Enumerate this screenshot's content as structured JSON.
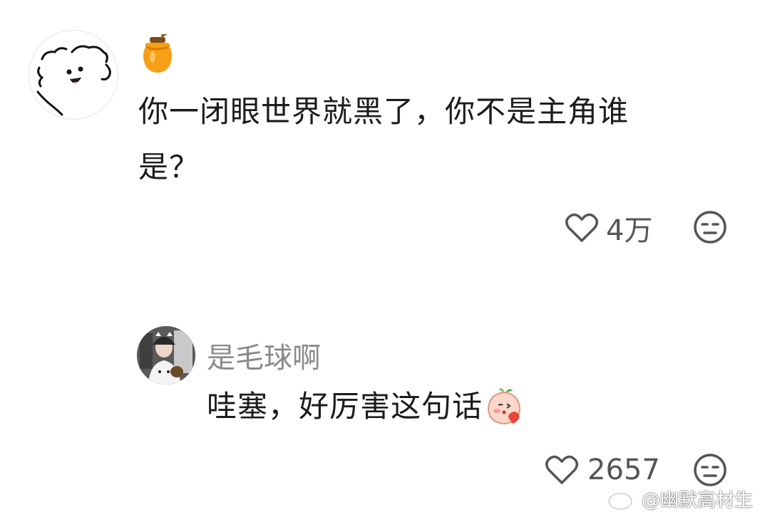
{
  "comment": {
    "text_line1": "你一闭眼世界就黑了，你不是主角谁",
    "text_line2": "是？",
    "like_count": "4万",
    "badge_icon": "honey-jar-icon",
    "avatar_icon": "doodle-dog-avatar",
    "like_icon": "heart-outline-icon",
    "dislike_icon": "meh-face-icon"
  },
  "reply": {
    "username": "是毛球啊",
    "text": "哇塞，好厉害这句话",
    "emoji": "shy-peach-emoji",
    "like_count": "2657",
    "avatar_icon": "user-photo-avatar",
    "like_icon": "heart-outline-icon",
    "dislike_icon": "meh-face-icon"
  },
  "watermark": {
    "text": "@幽默高材生",
    "icon": "weibo-logo-icon"
  }
}
